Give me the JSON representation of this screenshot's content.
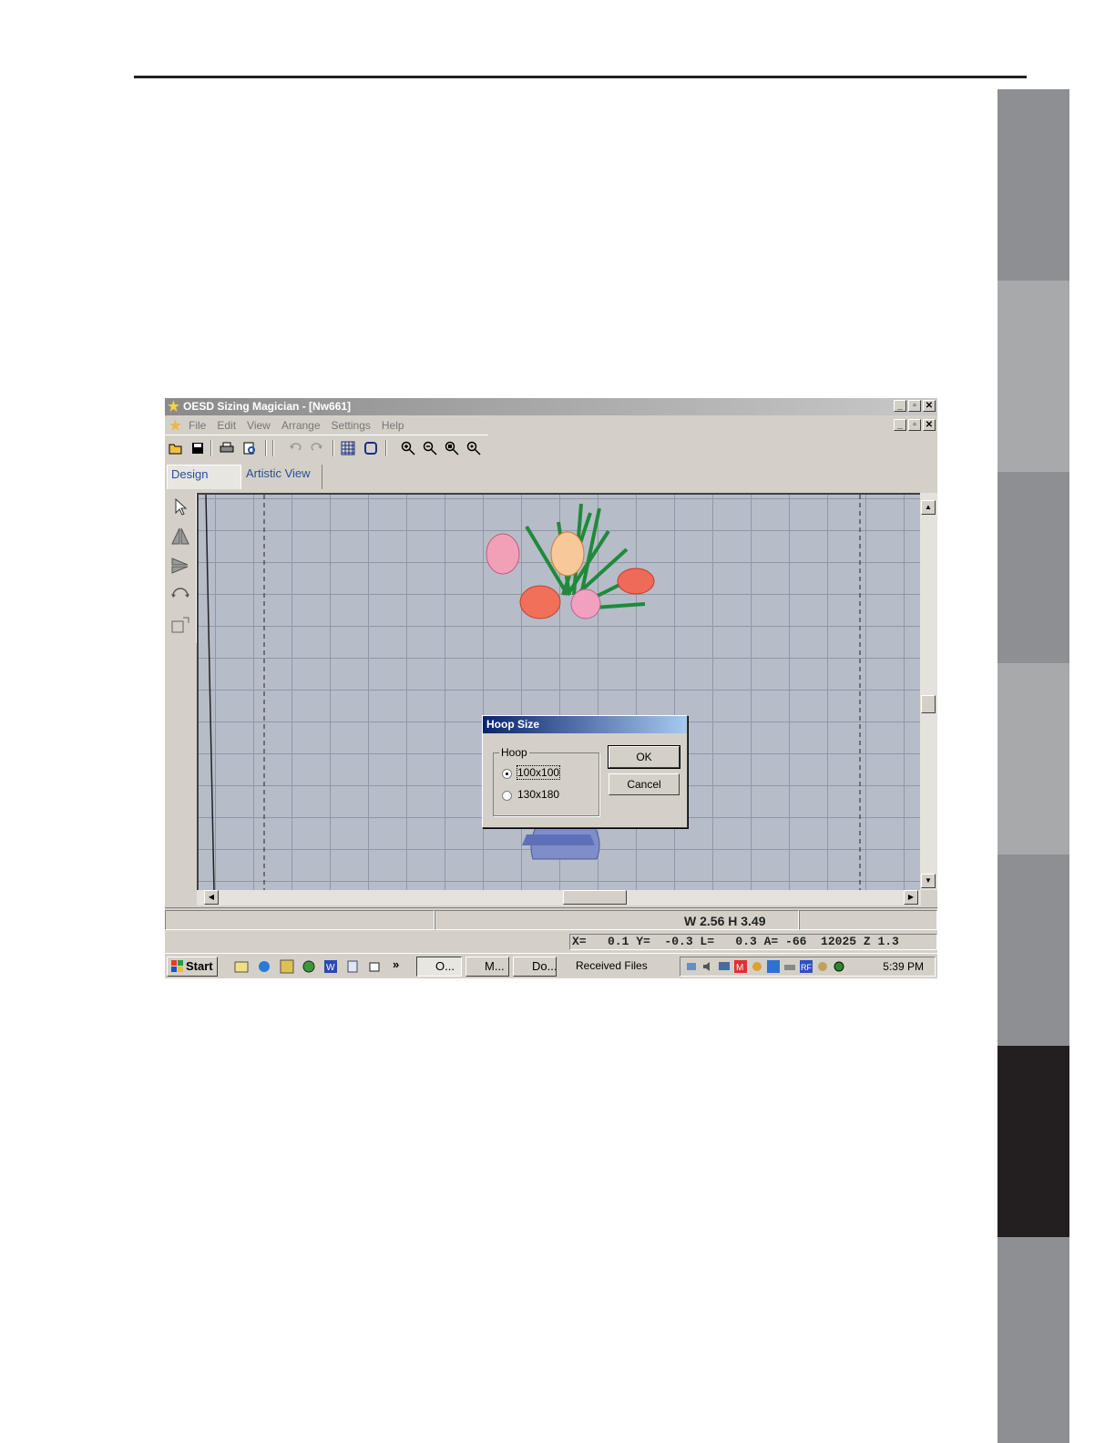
{
  "app": {
    "title": "OESD Sizing Magician - [Nw661]",
    "menus": [
      "File",
      "Edit",
      "View",
      "Arrange",
      "Settings",
      "Help"
    ],
    "window_controls": [
      "_",
      "▫",
      "✕"
    ]
  },
  "toolbar": {
    "icons": [
      "open-folder-icon",
      "save-icon",
      "print-icon",
      "print-preview-icon",
      "undo-icon",
      "redo-icon",
      "grid-icon",
      "hoop-icon",
      "zoom-in-icon",
      "zoom-out-icon",
      "zoom-fit-icon",
      "zoom-actual-icon"
    ]
  },
  "view_tabs": [
    "Design",
    "Artistic View"
  ],
  "left_tools": [
    "select-arrow-icon",
    "mirror-vertical-icon",
    "mirror-horizontal-icon",
    "rotate-icon",
    "resize-icon"
  ],
  "dialog": {
    "title": "Hoop Size",
    "group_label": "Hoop",
    "options": [
      "100x100",
      "130x180"
    ],
    "selected_option": "100x100",
    "ok_label": "OK",
    "cancel_label": "Cancel"
  },
  "status": {
    "size": "W 2.56 H 3.49",
    "coords": "X=   0.1 Y=  -0.3 L=   0.3 A= -66  12025 Z 1.3"
  },
  "taskbar": {
    "start_label": "Start",
    "tasks": [
      "O...",
      "M...",
      "Do..."
    ],
    "received": "Received Files",
    "clock": "5:39 PM"
  },
  "colors": {
    "side_tabs": [
      "#8e8f92",
      "#a8a9ab",
      "#8e8f92",
      "#a8a9ab",
      "#8e8f92",
      "#231f20",
      "#8e8f92"
    ],
    "canvas": "#b6bdc8",
    "dialog_title": "#0a246a"
  }
}
